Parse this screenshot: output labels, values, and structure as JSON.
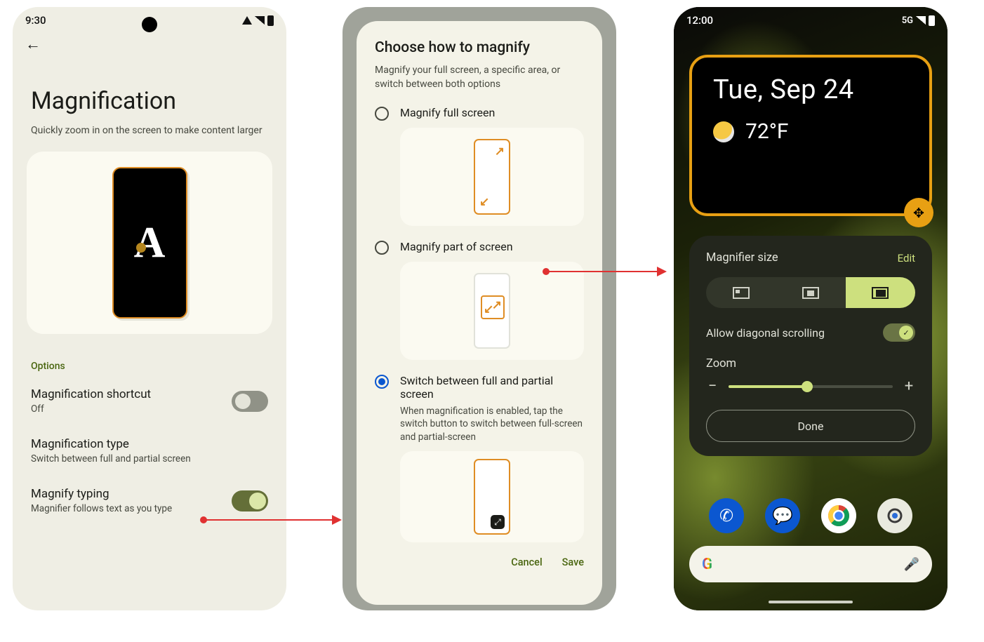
{
  "screen1": {
    "time": "9:30",
    "title": "Magnification",
    "subtitle": "Quickly zoom in on the screen to make content larger",
    "options_label": "Options",
    "rows": {
      "shortcut": {
        "title": "Magnification shortcut",
        "subtitle": "Off",
        "on": false
      },
      "type": {
        "title": "Magnification type",
        "subtitle": "Switch between full and partial screen"
      },
      "typing": {
        "title": "Magnify typing",
        "subtitle": "Magnifier follows text as you type",
        "on": true
      }
    }
  },
  "screen2": {
    "title": "Choose how to magnify",
    "subtitle": "Magnify your full screen, a specific area, or switch between both options",
    "opt1": "Magnify full screen",
    "opt2": "Magnify part of screen",
    "opt3": "Switch between full and partial screen",
    "opt3_sub": "When magnification is enabled, tap the switch button to switch between full-screen and partial-screen",
    "cancel": "Cancel",
    "save": "Save"
  },
  "screen3": {
    "time": "12:00",
    "network": "5G",
    "date": "Tue, Sep 24",
    "temp": "72°F",
    "sheet": {
      "title": "Magnifier size",
      "edit": "Edit",
      "diag": "Allow diagonal scrolling",
      "zoom": "Zoom",
      "done": "Done"
    }
  }
}
